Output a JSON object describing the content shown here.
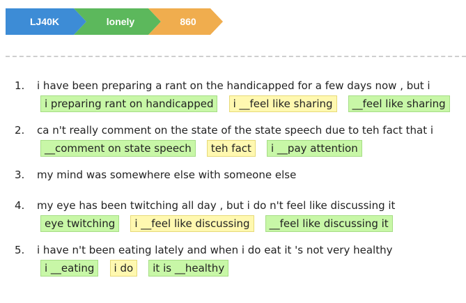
{
  "breadcrumb": {
    "items": [
      {
        "label": "LJ40K",
        "color": "#3d8cd6"
      },
      {
        "label": "lonely",
        "color": "#5cb85c"
      },
      {
        "label": "860",
        "color": "#f0ad4e"
      }
    ]
  },
  "results": [
    {
      "number": "1.",
      "sentence": "i have been preparing a rant on the handicapped for a few days now , but i",
      "tags": [
        {
          "text": "i preparing rant on handicapped",
          "style": "green"
        },
        {
          "text": "i __feel like sharing",
          "style": "yellow"
        },
        {
          "text": "__feel like sharing",
          "style": "green"
        }
      ]
    },
    {
      "number": "2.",
      "sentence": "ca n't really comment on the state of the state speech due to teh fact that i",
      "tags": [
        {
          "text": "__comment on state speech",
          "style": "green"
        },
        {
          "text": "teh fact",
          "style": "yellow"
        },
        {
          "text": "i __pay attention",
          "style": "green"
        }
      ]
    },
    {
      "number": "3.",
      "sentence": "my mind was somewhere else with someone else",
      "tags": []
    },
    {
      "number": "4.",
      "sentence": "my eye has been twitching all day , but i do n't feel like discussing it",
      "tags": [
        {
          "text": "eye twitching",
          "style": "green"
        },
        {
          "text": "i __feel like discussing",
          "style": "yellow"
        },
        {
          "text": "__feel like discussing it",
          "style": "green"
        }
      ]
    },
    {
      "number": "5.",
      "sentence": "i have n't been eating lately and when i do eat it 's not very healthy",
      "tags": [
        {
          "text": "i __eating",
          "style": "green"
        },
        {
          "text": "i do",
          "style": "yellow"
        },
        {
          "text": "it is __healthy",
          "style": "green"
        }
      ]
    }
  ]
}
